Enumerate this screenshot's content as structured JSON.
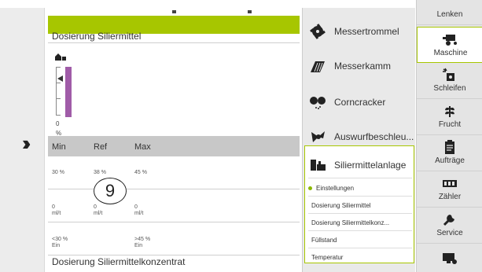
{
  "panel": {
    "title": "Dosierung Siliermittel",
    "gauge_zero": "0",
    "gauge_unit": "%",
    "table_headers": [
      "Min",
      "Ref",
      "Max"
    ],
    "row1": [
      "30 %",
      "38 %",
      "45 %"
    ],
    "row2": [
      [
        "0",
        "ml/t"
      ],
      [
        "0",
        "ml/t"
      ],
      [
        "0",
        "ml/t"
      ]
    ],
    "row3": [
      [
        "<30 %",
        "Ein"
      ],
      [
        ">45 %",
        "Ein"
      ]
    ],
    "annotation": "9",
    "bottom_title": "Dosierung Siliermittelkonzentrat"
  },
  "menu": {
    "items": [
      {
        "label": "Messertrommel",
        "icon": "drum-icon"
      },
      {
        "label": "Messerkamm",
        "icon": "knife-bar-icon"
      },
      {
        "label": "Corncracker",
        "icon": "corncracker-icon"
      },
      {
        "label": "Auswurfbeschleu...",
        "icon": "accelerator-icon"
      },
      {
        "label": "Siliermittelanlage",
        "icon": "silage-agent-icon"
      }
    ],
    "subitems": [
      "Einstellungen",
      "Dosierung Siliermittel",
      "Dosierung Siliermittelkonz...",
      "Füllstand",
      "Temperatur"
    ]
  },
  "nav": {
    "items": [
      {
        "label": "Lenken",
        "icon": "steering-icon"
      },
      {
        "label": "Maschine",
        "icon": "harvester-icon",
        "active": true
      },
      {
        "label": "Schleifen",
        "icon": "sharpen-icon"
      },
      {
        "label": "Frucht",
        "icon": "crop-icon"
      },
      {
        "label": "Aufträge",
        "icon": "clipboard-icon"
      },
      {
        "label": "Zähler",
        "icon": "counter-icon"
      },
      {
        "label": "Service",
        "icon": "wrench-icon"
      }
    ]
  },
  "colors": {
    "accent": "#a7c600",
    "gauge": "#a05ca8",
    "header_bg": "#c8c8c8"
  }
}
